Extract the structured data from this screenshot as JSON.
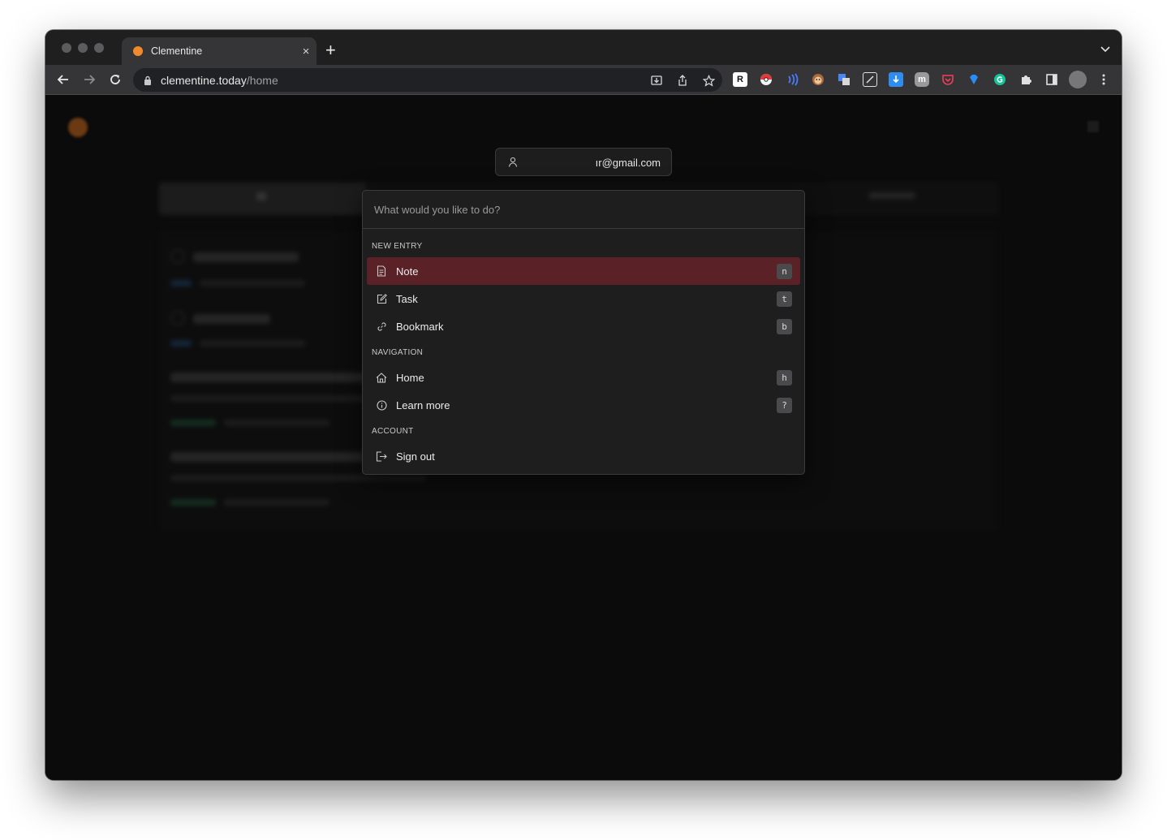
{
  "browser": {
    "tab_title": "Clementine",
    "tab_close": "×",
    "new_tab": "+",
    "url_host": "clementine.today",
    "url_path": "/home"
  },
  "extensions": [
    "R",
    "pokeball-icon",
    "sound-waves-icon",
    "monkey-icon",
    "translate-icon",
    "notes-icon",
    "download-icon",
    "m",
    "pocket-icon",
    "gem-icon",
    "grammarly-icon",
    "puzzle-icon",
    "sidebar-icon",
    "avatar"
  ],
  "account": {
    "email": "ır@gmail.com"
  },
  "palette": {
    "placeholder": "What would you like to do?",
    "sections": [
      {
        "label": "NEW ENTRY",
        "items": [
          {
            "label": "Note",
            "key": "n",
            "icon": "document-icon",
            "active": true
          },
          {
            "label": "Task",
            "key": "t",
            "icon": "edit-icon",
            "active": false
          },
          {
            "label": "Bookmark",
            "key": "b",
            "icon": "link-icon",
            "active": false
          }
        ]
      },
      {
        "label": "NAVIGATION",
        "items": [
          {
            "label": "Home",
            "key": "h",
            "icon": "home-icon",
            "active": false
          },
          {
            "label": "Learn more",
            "key": "?",
            "icon": "info-icon",
            "active": false
          }
        ]
      },
      {
        "label": "ACCOUNT",
        "items": [
          {
            "label": "Sign out",
            "icon": "sign-out-icon",
            "active": false
          }
        ]
      }
    ]
  },
  "colors": {
    "accent_active": "#5a2126",
    "favicon": "#f08a2c"
  }
}
